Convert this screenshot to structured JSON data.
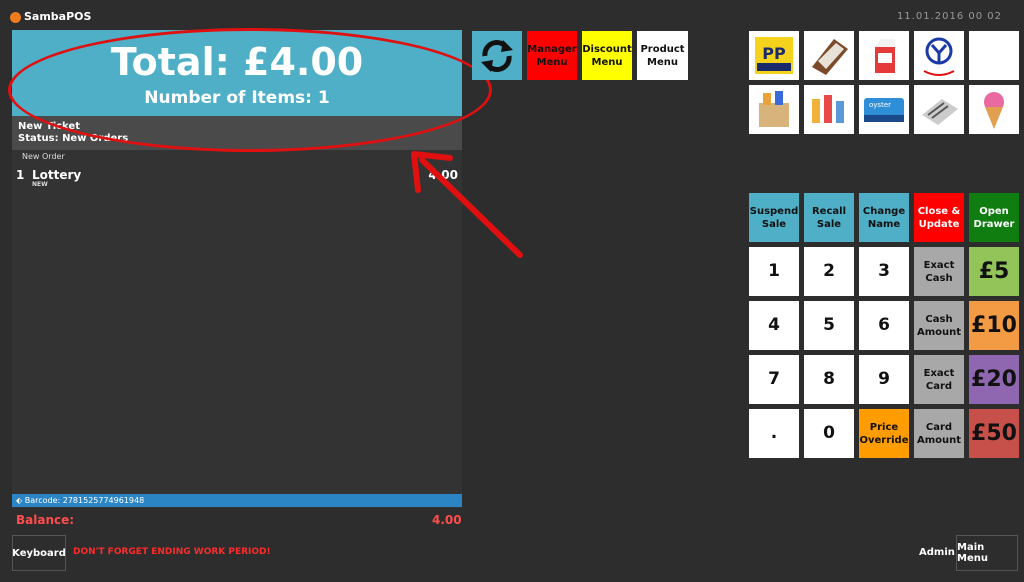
{
  "app": {
    "title": "SambaPOS",
    "datetime": "11.01.2016 00 02"
  },
  "ticket": {
    "total": "Total: £4.00",
    "items": "Number of Items: 1",
    "header_title": "New Ticket",
    "header_status": "Status: New Orders",
    "order_label": "New Order",
    "lines": [
      {
        "qty": "1",
        "name": "Lottery",
        "tag": "NEW",
        "price": "4.00"
      }
    ],
    "barcode": "Barcode: 2781525774961948",
    "balance_label": "Balance:",
    "balance_value": "4.00"
  },
  "top_buttons": {
    "manager": "Manager Menu",
    "discount": "Discount Menu",
    "product": "Product Menu"
  },
  "colors": {
    "accent": "#4eafc7",
    "danger": "#ff0000",
    "yellow": "#ffff00",
    "green": "#0f7d0f",
    "orange": "#ff9d00"
  },
  "actions": {
    "suspend": "Suspend Sale",
    "recall": "Recall Sale",
    "change_name": "Change Name",
    "close_update": "Close & Update",
    "open_drawer": "Open Drawer"
  },
  "keypad": {
    "k1": "1",
    "k2": "2",
    "k3": "3",
    "k4": "4",
    "k5": "5",
    "k6": "6",
    "k7": "7",
    "k8": "8",
    "k9": "9",
    "kdot": ".",
    "k0": "0",
    "price_override": "Price Override",
    "exact_cash": "Exact Cash",
    "cash_amount": "Cash Amount",
    "exact_card": "Exact Card",
    "card_amount": "Card Amount",
    "p5": "£5",
    "p10": "£10",
    "p20": "£20",
    "p50": "£50"
  },
  "footer": {
    "keyboard": "Keyboard",
    "warning": "DON'T FORGET ENDING WORK PERIOD!",
    "admin": "Admin",
    "main_menu": "Main Menu"
  }
}
